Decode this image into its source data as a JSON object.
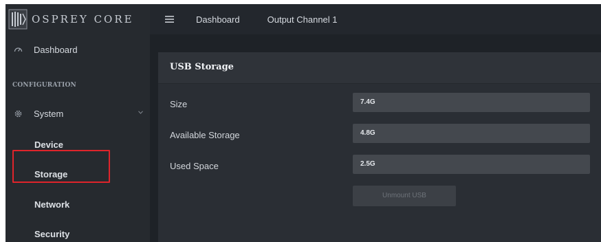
{
  "brand": {
    "name": "OSPREY CORE",
    "logo_icon": "osprey-logo-icon"
  },
  "topbar": {
    "menu_icon": "hamburger-menu-icon",
    "links": [
      "Dashboard",
      "Output Channel 1"
    ]
  },
  "sidebar": {
    "dashboard": {
      "label": "Dashboard",
      "icon": "speedometer-icon"
    },
    "section_heading": "CONFIGURATION",
    "system": {
      "label": "System",
      "icon": "gear-icon",
      "chevron": "chevron-down-icon"
    },
    "system_items": [
      "Device",
      "Storage",
      "Network",
      "Security"
    ],
    "highlighted_item": "Storage",
    "highlight_color": "#e0242b"
  },
  "main": {
    "card_title": "USB Storage",
    "fields": [
      {
        "label": "Size",
        "value": "7.4G"
      },
      {
        "label": "Available Storage",
        "value": "4.8G"
      },
      {
        "label": "Used Space",
        "value": "2.5G"
      }
    ],
    "unmount_label": "Unmount USB"
  }
}
